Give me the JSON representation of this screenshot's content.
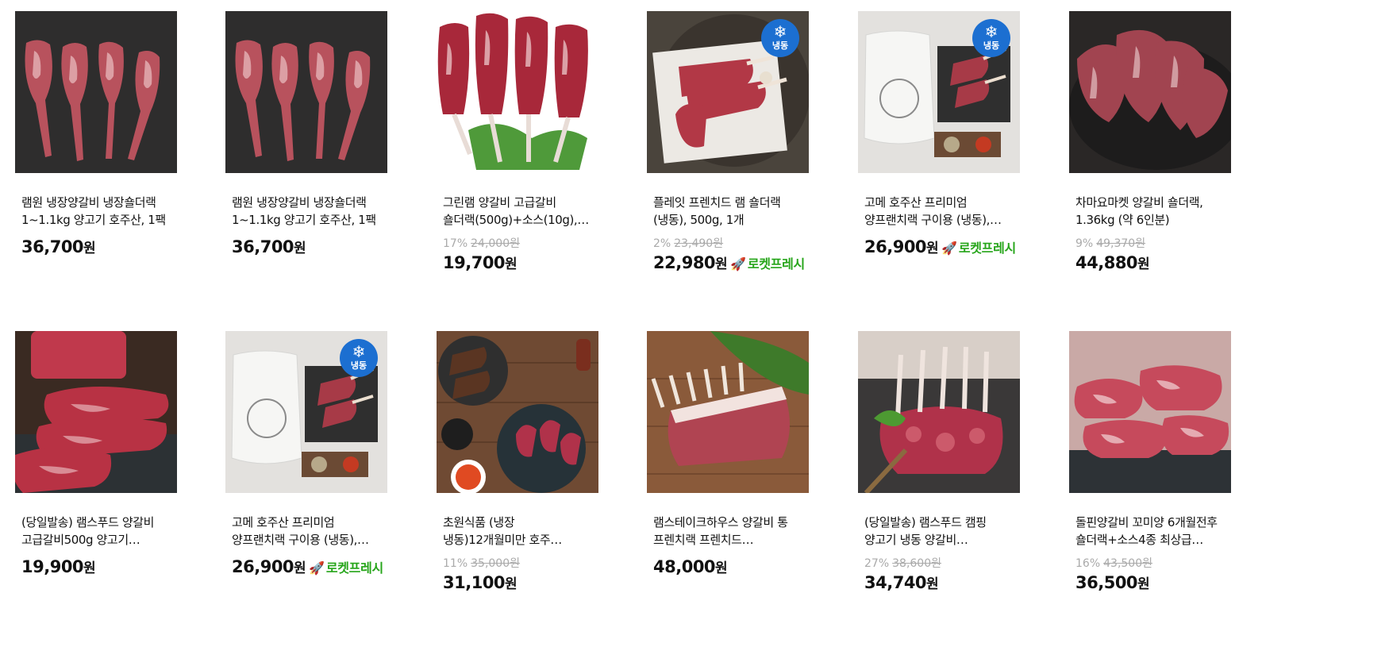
{
  "badge_label": "냉동",
  "currency": "원",
  "rocket_label": "로켓프레시",
  "colors": {
    "frozen_badge": "#1c6fd1",
    "rocket": "#26a51a",
    "old_price": "#aaaaaa"
  },
  "products": [
    {
      "name_line1": "램원 냉장양갈비 냉장숄더랙",
      "name_line2": "1~1.1kg 양고기 호주산, 1팩",
      "discount": "",
      "original_price": "",
      "price": "36,700",
      "frozen": false,
      "rocket": false,
      "image": "lamb-chops-dark-board"
    },
    {
      "name_line1": "램원 냉장양갈비 냉장숄더랙",
      "name_line2": "1~1.1kg 양고기 호주산, 1팩",
      "discount": "",
      "original_price": "",
      "price": "36,700",
      "frozen": false,
      "rocket": false,
      "image": "lamb-chops-dark-board"
    },
    {
      "name_line1": "그린램 양갈비 고급갈비",
      "name_line2": "숄더랙(500g)+소스(10g),…",
      "discount": "17%",
      "original_price": "24,000원",
      "price": "19,700",
      "frozen": false,
      "rocket": false,
      "image": "lamb-chops-white"
    },
    {
      "name_line1": "플레잇 프렌치드 램 숄더랙",
      "name_line2": "(냉동), 500g, 1개",
      "discount": "2%",
      "original_price": "23,490원",
      "price": "22,980",
      "frozen": true,
      "rocket": true,
      "image": "lamb-chops-paper"
    },
    {
      "name_line1": "고메 호주산 프리미엄",
      "name_line2": "양프랜치랙 구이용 (냉동),…",
      "discount": "",
      "original_price": "",
      "price": "26,900",
      "frozen": true,
      "rocket": true,
      "image": "lamb-rack-package"
    },
    {
      "name_line1": "차마요마켓 양갈비 숄더랙,",
      "name_line2": "1.36kg (약 6인분)",
      "discount": "9%",
      "original_price": "49,370원",
      "price": "44,880",
      "frozen": false,
      "rocket": false,
      "image": "lamb-pile-bowl"
    },
    {
      "name_line1": "(당일발송) 램스푸드 양갈비",
      "name_line2": "고급갈비500g 양고기…",
      "discount": "",
      "original_price": "",
      "price": "19,900",
      "frozen": false,
      "rocket": false,
      "image": "lamb-slabs-slate"
    },
    {
      "name_line1": "고메 호주산 프리미엄",
      "name_line2": "양프랜치랙 구이용 (냉동),…",
      "discount": "",
      "original_price": "",
      "price": "26,900",
      "frozen": true,
      "rocket": true,
      "image": "lamb-rack-package"
    },
    {
      "name_line1": "초원식품 (냉장",
      "name_line2": "냉동)12개월미만 호주…",
      "discount": "11%",
      "original_price": "35,000원",
      "price": "31,100",
      "frozen": false,
      "rocket": false,
      "image": "lamb-grilled-wood"
    },
    {
      "name_line1": "램스테이크하우스 양갈비 통",
      "name_line2": "프렌치랙 프렌치드…",
      "discount": "",
      "original_price": "",
      "price": "48,000",
      "frozen": false,
      "rocket": false,
      "image": "lamb-rack-leaf"
    },
    {
      "name_line1": "(당일발송) 램스푸드 캠핑",
      "name_line2": "양고기 냉동 양갈비…",
      "discount": "27%",
      "original_price": "38,600원",
      "price": "34,740",
      "frozen": false,
      "rocket": false,
      "image": "lamb-rack-fork"
    },
    {
      "name_line1": "돌핀양갈비 꼬미양 6개월전후",
      "name_line2": "숄더랙+소스4종 최상급…",
      "discount": "16%",
      "original_price": "43,500원",
      "price": "36,500",
      "frozen": false,
      "rocket": false,
      "image": "lamb-slices-platter"
    }
  ]
}
